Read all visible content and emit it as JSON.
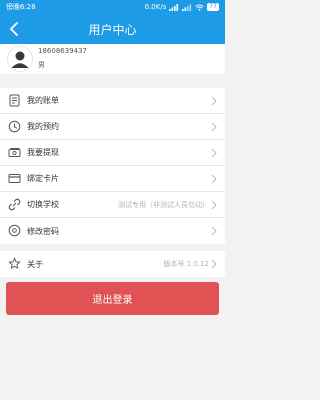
{
  "status_bar": {
    "carrier_time": "傍晚6:28",
    "network": "0.0K/s",
    "battery": "77"
  },
  "header": {
    "title": "用户中心"
  },
  "profile": {
    "phone": "18608639437",
    "gender": "男"
  },
  "menu": [
    {
      "label": "我的账单",
      "icon": "bill-icon"
    },
    {
      "label": "我的预约",
      "icon": "clock-icon"
    },
    {
      "label": "我要提现",
      "icon": "cash-icon"
    },
    {
      "label": "绑定卡片",
      "icon": "card-icon"
    },
    {
      "label": "切换学校",
      "icon": "link-icon",
      "value": "测试专用（非测试人员勿动）"
    },
    {
      "label": "修改密码",
      "icon": "lock-icon"
    }
  ],
  "about": {
    "label": "关于",
    "icon": "star-icon",
    "version": "版本号 1.0.12"
  },
  "logout": {
    "label": "退出登录"
  },
  "colors": {
    "primary": "#1e9be6",
    "danger": "#e05254",
    "background": "#f2f2f2"
  }
}
